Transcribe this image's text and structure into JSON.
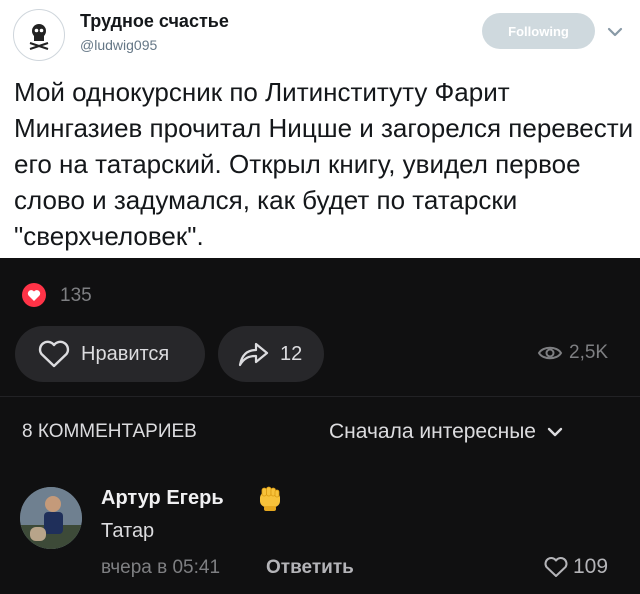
{
  "tweet": {
    "author_name": "Трудное счастье",
    "author_handle": "@ludwig095",
    "follow_label": "Following",
    "text": "Мой однокурсник по Литинституту Фарит Мингазиев прочитал Ницше и загорелся перевести его на татарский. Открыл книгу, увидел первое слово и задумался, как будет по татарски \"сверхчеловек\"."
  },
  "post": {
    "reactions_count": "135",
    "like_label": "Нравится",
    "share_count": "12",
    "views_count": "2,5K"
  },
  "comments": {
    "count_label": "8 КОММЕНТАРИЕВ",
    "sort_label": "Сначала интересные",
    "items": [
      {
        "author": "Артур Егерь",
        "emoji_icon": "fist-emoji-icon",
        "text": "Татар",
        "time": "вчера в 05:41",
        "reply_label": "Ответить",
        "likes": "109"
      }
    ]
  },
  "colors": {
    "dark_background": "#101011",
    "reaction_red": "#ff3347",
    "button_gray": "#27272a"
  }
}
